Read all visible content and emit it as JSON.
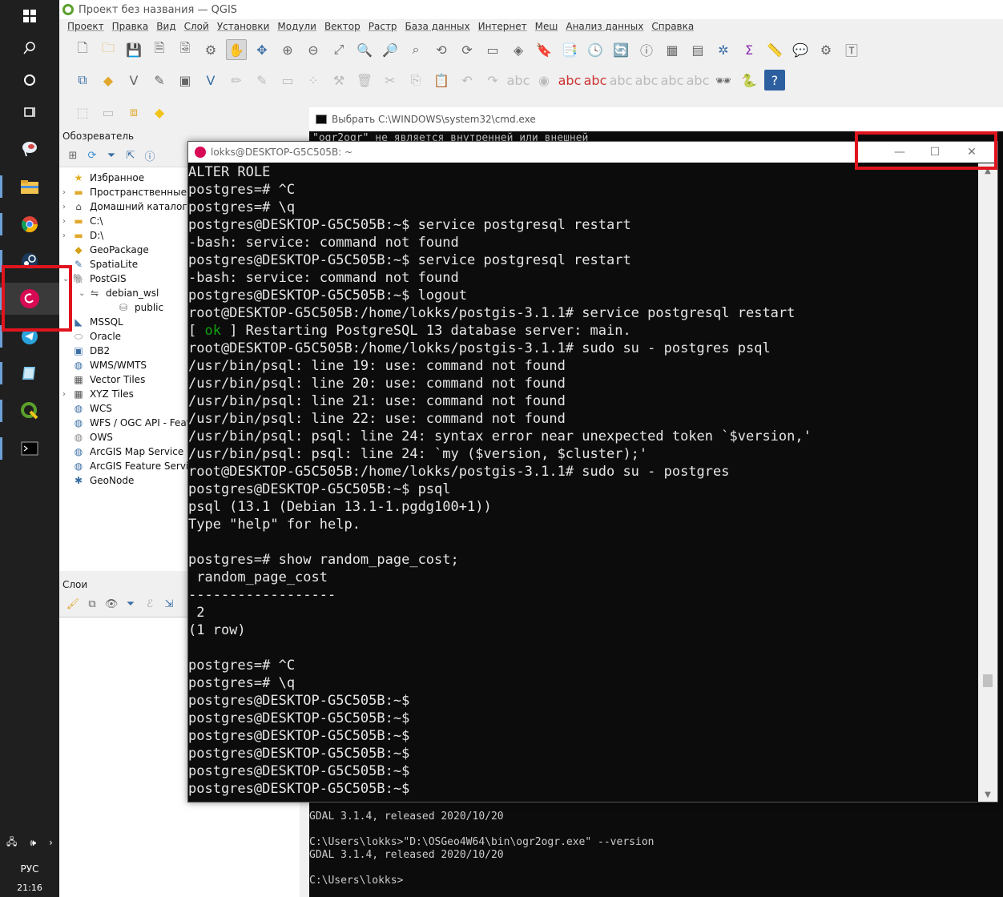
{
  "qgis": {
    "title": "Проект без названия — QGIS",
    "menu": [
      "Проект",
      "Правка",
      "Вид",
      "Слой",
      "Установки",
      "Модули",
      "Вектор",
      "Растр",
      "База данных",
      "Интернет",
      "Меш",
      "Анализ данных",
      "Справка"
    ],
    "browser_title": "Обозреватель",
    "layers_title": "Слои",
    "browser_items": [
      {
        "label": "Избранное",
        "icon": "star-icon",
        "arrow": ""
      },
      {
        "label": "Пространственные з",
        "icon": "folder-icon",
        "arrow": "›"
      },
      {
        "label": "Домашний каталог",
        "icon": "home-icon",
        "arrow": "›"
      },
      {
        "label": "C:\\",
        "icon": "folder-icon",
        "arrow": "›"
      },
      {
        "label": "D:\\",
        "icon": "folder-icon",
        "arrow": "›"
      },
      {
        "label": "GeoPackage",
        "icon": "geopackage-icon",
        "arrow": ""
      },
      {
        "label": "SpatiaLite",
        "icon": "spatialite-icon",
        "arrow": ""
      },
      {
        "label": "PostGIS",
        "icon": "postgis-icon",
        "arrow": "⌄"
      },
      {
        "label": "debian_wsl",
        "icon": "connection-icon",
        "arrow": "⌄"
      },
      {
        "label": "public",
        "icon": "schema-icon",
        "arrow": ""
      },
      {
        "label": "MSSQL",
        "icon": "mssql-icon",
        "arrow": ""
      },
      {
        "label": "Oracle",
        "icon": "oracle-icon",
        "arrow": ""
      },
      {
        "label": "DB2",
        "icon": "db2-icon",
        "arrow": ""
      },
      {
        "label": "WMS/WMTS",
        "icon": "wms-icon",
        "arrow": ""
      },
      {
        "label": "Vector Tiles",
        "icon": "vector-tiles-icon",
        "arrow": ""
      },
      {
        "label": "XYZ Tiles",
        "icon": "xyz-tiles-icon",
        "arrow": "›"
      },
      {
        "label": "WCS",
        "icon": "wcs-icon",
        "arrow": ""
      },
      {
        "label": "WFS / OGC API - Feat",
        "icon": "wfs-icon",
        "arrow": ""
      },
      {
        "label": "OWS",
        "icon": "ows-icon",
        "arrow": ""
      },
      {
        "label": "ArcGIS Map Service",
        "icon": "arcgis-map-icon",
        "arrow": ""
      },
      {
        "label": "ArcGIS Feature Service",
        "icon": "arcgis-feature-icon",
        "arrow": ""
      },
      {
        "label": "GeoNode",
        "icon": "geonode-icon",
        "arrow": ""
      }
    ]
  },
  "cmd": {
    "title": "Выбрать C:\\WINDOWS\\system32\\cmd.exe",
    "top_line": "\"ogr2ogr\" не является внутренней или внешней",
    "lines": [
      "GDAL 3.1.4, released 2020/10/20",
      "",
      "C:\\Users\\lokks>\"D:\\OSGeo4W64\\bin\\ogr2ogr.exe\" --version",
      "GDAL 3.1.4, released 2020/10/20",
      "",
      "C:\\Users\\lokks>"
    ]
  },
  "terminal": {
    "title": "lokks@DESKTOP-G5C505B: ~",
    "controls": {
      "minimize": "—",
      "maximize": "☐",
      "close": "✕"
    },
    "lines": [
      "ALTER ROLE",
      "postgres=# ^C",
      "postgres=# \\q",
      "postgres@DESKTOP-G5C505B:~$ service postgresql restart",
      "-bash: service: command not found",
      "postgres@DESKTOP-G5C505B:~$ service postgresql restart",
      "-bash: service: command not found",
      "postgres@DESKTOP-G5C505B:~$ logout",
      "root@DESKTOP-G5C505B:/home/lokks/postgis-3.1.1# service postgresql restart",
      "OK_LINE",
      "root@DESKTOP-G5C505B:/home/lokks/postgis-3.1.1# sudo su - postgres psql",
      "/usr/bin/psql: line 19: use: command not found",
      "/usr/bin/psql: line 20: use: command not found",
      "/usr/bin/psql: line 21: use: command not found",
      "/usr/bin/psql: line 22: use: command not found",
      "/usr/bin/psql: psql: line 24: syntax error near unexpected token `$version,'",
      "/usr/bin/psql: psql: line 24: `my ($version, $cluster);'",
      "root@DESKTOP-G5C505B:/home/lokks/postgis-3.1.1# sudo su - postgres",
      "postgres@DESKTOP-G5C505B:~$ psql",
      "psql (13.1 (Debian 13.1-1.pgdg100+1))",
      "Type \"help\" for help.",
      "",
      "postgres=# show random_page_cost;",
      " random_page_cost",
      "------------------",
      " 2",
      "(1 row)",
      "",
      "postgres=# ^C",
      "postgres=# \\q",
      "postgres@DESKTOP-G5C505B:~$",
      "postgres@DESKTOP-G5C505B:~$",
      "postgres@DESKTOP-G5C505B:~$",
      "postgres@DESKTOP-G5C505B:~$",
      "postgres@DESKTOP-G5C505B:~$",
      "postgres@DESKTOP-G5C505B:~$"
    ],
    "ok_line": {
      "open": "[ ",
      "ok": "ok",
      "rest": " ] Restarting PostgreSQL 13 database server: main."
    }
  },
  "tray": {
    "lang": "РУС",
    "time": "21:16"
  },
  "colors": {
    "highlight_red": "#e0141e",
    "ok_green": "#13a10e",
    "debian": "#d70a53",
    "qgis_green": "#5aa02c"
  }
}
